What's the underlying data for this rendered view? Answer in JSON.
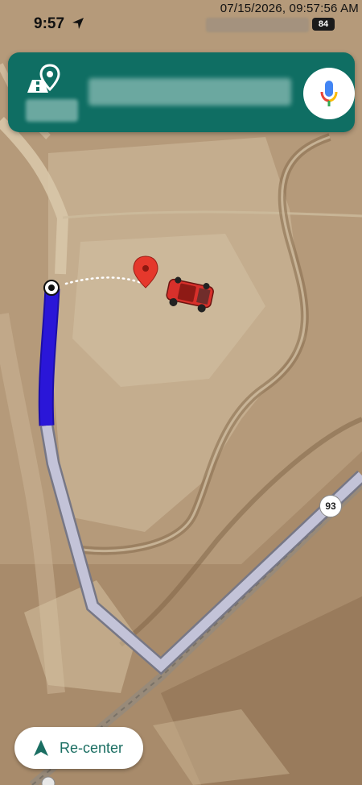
{
  "status": {
    "time": "9:57",
    "timestamp": "07/15/2026, 09:57:56 AM",
    "battery": "84"
  },
  "map": {
    "route_shield": "93",
    "colors": {
      "route_traveled": "#2a16d8",
      "route_remaining": "#c3c3d8",
      "route_outline": "#777785",
      "pin": "#e5382c",
      "car": "#d8302b"
    }
  },
  "search": {
    "mic_icon": "microphone-icon"
  },
  "buttons": {
    "recenter_label": "Re-center"
  }
}
